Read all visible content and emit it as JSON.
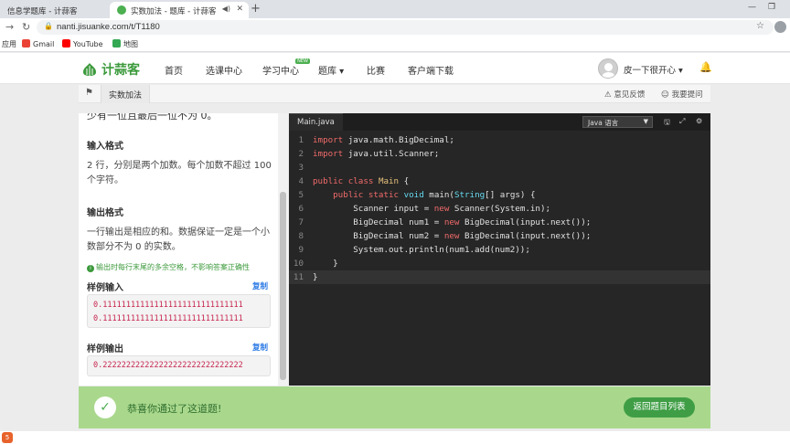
{
  "browser": {
    "tabs": [
      {
        "title": "信息学题库 - 计蒜客",
        "active": false
      },
      {
        "title": "实数加法 - 题库 - 计蒜客",
        "active": true
      }
    ],
    "url": "nanti.jisuanke.com/t/T1180",
    "bookmarks": [
      "应用",
      "Gmail",
      "YouTube",
      "地图"
    ]
  },
  "site": {
    "logo": "计蒜客",
    "nav": [
      "首页",
      "选课中心",
      "学习中心",
      "题库 ▾",
      "比赛",
      "客户端下载"
    ],
    "nav_badge": "NEW",
    "user": "皮一下很开心 ▾"
  },
  "toolbar": {
    "problem_tab": "实数加法",
    "feedback": "意见反馈",
    "ask": "我要提问"
  },
  "problem": {
    "cut_line": "少有一位且最后一位不为 0。",
    "input_title": "输入格式",
    "input_text": "2 行，分别是两个加数。每个加数不超过 100 个字符。",
    "output_title": "输出格式",
    "output_text": "一行输出是相应的和。数据保证一定是一个小数部分不为 0 的实数。",
    "tip": "输出时每行末尾的多余空格，不影响答案正确性",
    "sample_input_title": "样例输入",
    "sample_input": [
      "0.111111111111111111111111111111",
      "0.111111111111111111111111111111"
    ],
    "sample_output_title": "样例输出",
    "sample_output": [
      "0.222222222222222222222222222222"
    ],
    "copy": "复制"
  },
  "editor": {
    "file": "Main.java",
    "language": "Java 语言",
    "lines": [
      "import java.math.BigDecimal;",
      "import java.util.Scanner;",
      "",
      "public class Main {",
      "    public static void main(String[] args) {",
      "        Scanner input = new Scanner(System.in);",
      "        BigDecimal num1 = new BigDecimal(input.next());",
      "        BigDecimal num2 = new BigDecimal(input.next());",
      "        System.out.println(num1.add(num2));",
      "    }",
      "}"
    ]
  },
  "result": {
    "message": "恭喜你通过了这道题!",
    "back_button": "返回题目列表"
  },
  "colors": {
    "brand": "#3c9a3c",
    "success_bar": "#a9d88c",
    "editor_bg": "#262626",
    "keyword": "#f06a6a"
  }
}
